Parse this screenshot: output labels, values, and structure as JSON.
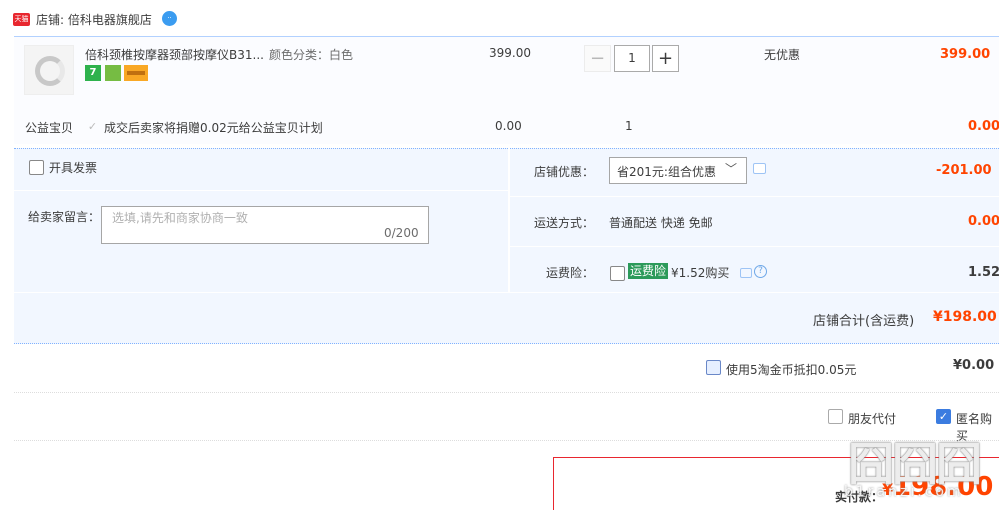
{
  "shop": {
    "badge": "天猫",
    "label": "店铺: 倍科电器旗舰店",
    "chat_badge": "··"
  },
  "item": {
    "title": "倍科颈椎按摩器颈部按摩仪B31...",
    "sku": "颜色分类：白色",
    "tag_seven": "7",
    "price": "399.00",
    "quantity": "1",
    "qty_minus": "−",
    "qty_plus": "+",
    "discount": "无优惠",
    "subtotal": "399.00"
  },
  "charity": {
    "label": "公益宝贝",
    "check_glyph": "✓",
    "text": "成交后卖家将捐赠0.02元给公益宝贝计划",
    "price": "0.00",
    "qty": "1",
    "subtotal": "0.00"
  },
  "invoice": {
    "label": "开具发票"
  },
  "message": {
    "label": "给卖家留言：",
    "placeholder": "选填,请先和商家协商一致",
    "counter": "0/200"
  },
  "shop_discount": {
    "label": "店铺优惠：",
    "selected": "省201元:组合优惠",
    "chevron": "﹀",
    "amount": "-201.00"
  },
  "shipping": {
    "label": "运送方式：",
    "value": "普通配送 快递 免邮",
    "amount": "0.00"
  },
  "insurance": {
    "label": "运费险：",
    "badge": "运费险",
    "price": "¥1.52购买",
    "help": "?",
    "amount": "1.52"
  },
  "shop_total": {
    "label": "店铺合计(含运费)",
    "amount": "¥198.00"
  },
  "coins": {
    "label": "使用5淘金币抵扣0.05元",
    "amount": "¥0.00"
  },
  "options": {
    "friend_pay": "朋友代付",
    "anonymous": "匿名购买",
    "anon_check": "✓"
  },
  "payment": {
    "label": "实付款：",
    "currency": "¥",
    "amount": "198.00"
  },
  "watermark": {
    "top": "囧囧囧",
    "bottom": "b1ranzi.com"
  }
}
